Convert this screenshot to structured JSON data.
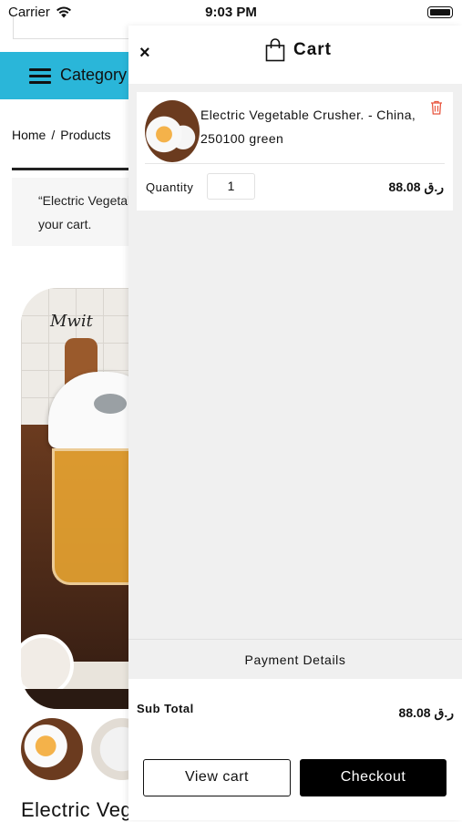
{
  "status_bar": {
    "carrier": "Carrier",
    "time": "9:03 PM"
  },
  "page": {
    "category_label": "Category",
    "breadcrumb": [
      "Home",
      "Products"
    ],
    "notice": "“Electric Vegetable Crusher.” has been added to your cart.",
    "logo_text": "Mwit",
    "product_title": "Electric Vegetable Crusher"
  },
  "cart": {
    "title": "Cart",
    "close_symbol": "×",
    "item": {
      "name": "Electric Vegetable Crusher. - China, 250100 green",
      "quantity_label": "Quantity",
      "quantity": "1",
      "price": "88.08 ر.ق"
    },
    "payment_details_label": "Payment Details",
    "subtotal_label": "Sub Total",
    "subtotal_value": "88.08 ر.ق",
    "view_cart_label": "View cart",
    "checkout_label": "Checkout"
  },
  "icons": {
    "wifi": "wifi-icon",
    "battery": "battery-icon",
    "bag": "shopping-bag-icon",
    "trash": "trash-icon",
    "menu": "hamburger-icon"
  },
  "colors": {
    "category_bar": "#2ab6d9",
    "checkout_button": "#000000",
    "trash_icon": "#e8563f"
  }
}
